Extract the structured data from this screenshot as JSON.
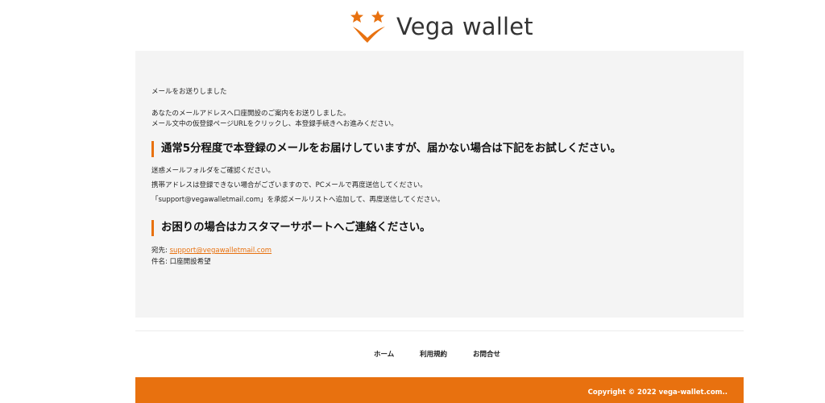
{
  "brand": {
    "name": "Vega wallet",
    "accent_color": "#e8710f",
    "logo_icon": "two-stars-v-mark-icon"
  },
  "main": {
    "sent_notice": "メールをお送りしました",
    "intro_line1": "あなたのメールアドレスへ口座開設のご案内をお送りしました。",
    "intro_line2": "メール文中の仮登録ページURLをクリックし、本登録手続きへお進みください。",
    "heading_not_received": "通常5分程度で本登録のメールをお届けしていますが、届かない場合は下記をお試しください。",
    "tips": [
      "迷惑メールフォルダをご確認ください。",
      "携帯アドレスは登録できない場合がございますので、PCメールで再度送信してください。",
      "「support@vegawalletmail.com」を承認メールリストへ追加して、再度送信してください。"
    ],
    "heading_support": "お困りの場合はカスタマーサポートへご連絡ください。",
    "to_label": "宛先: ",
    "to_email": "support@vegawalletmail.com",
    "subject_line": "件名: 口座開設希望"
  },
  "footer": {
    "nav": {
      "home": "ホーム",
      "terms": "利用規約",
      "contact": "お問合せ"
    },
    "copyright": "Copyright © 2022 vega-wallet.com.."
  }
}
